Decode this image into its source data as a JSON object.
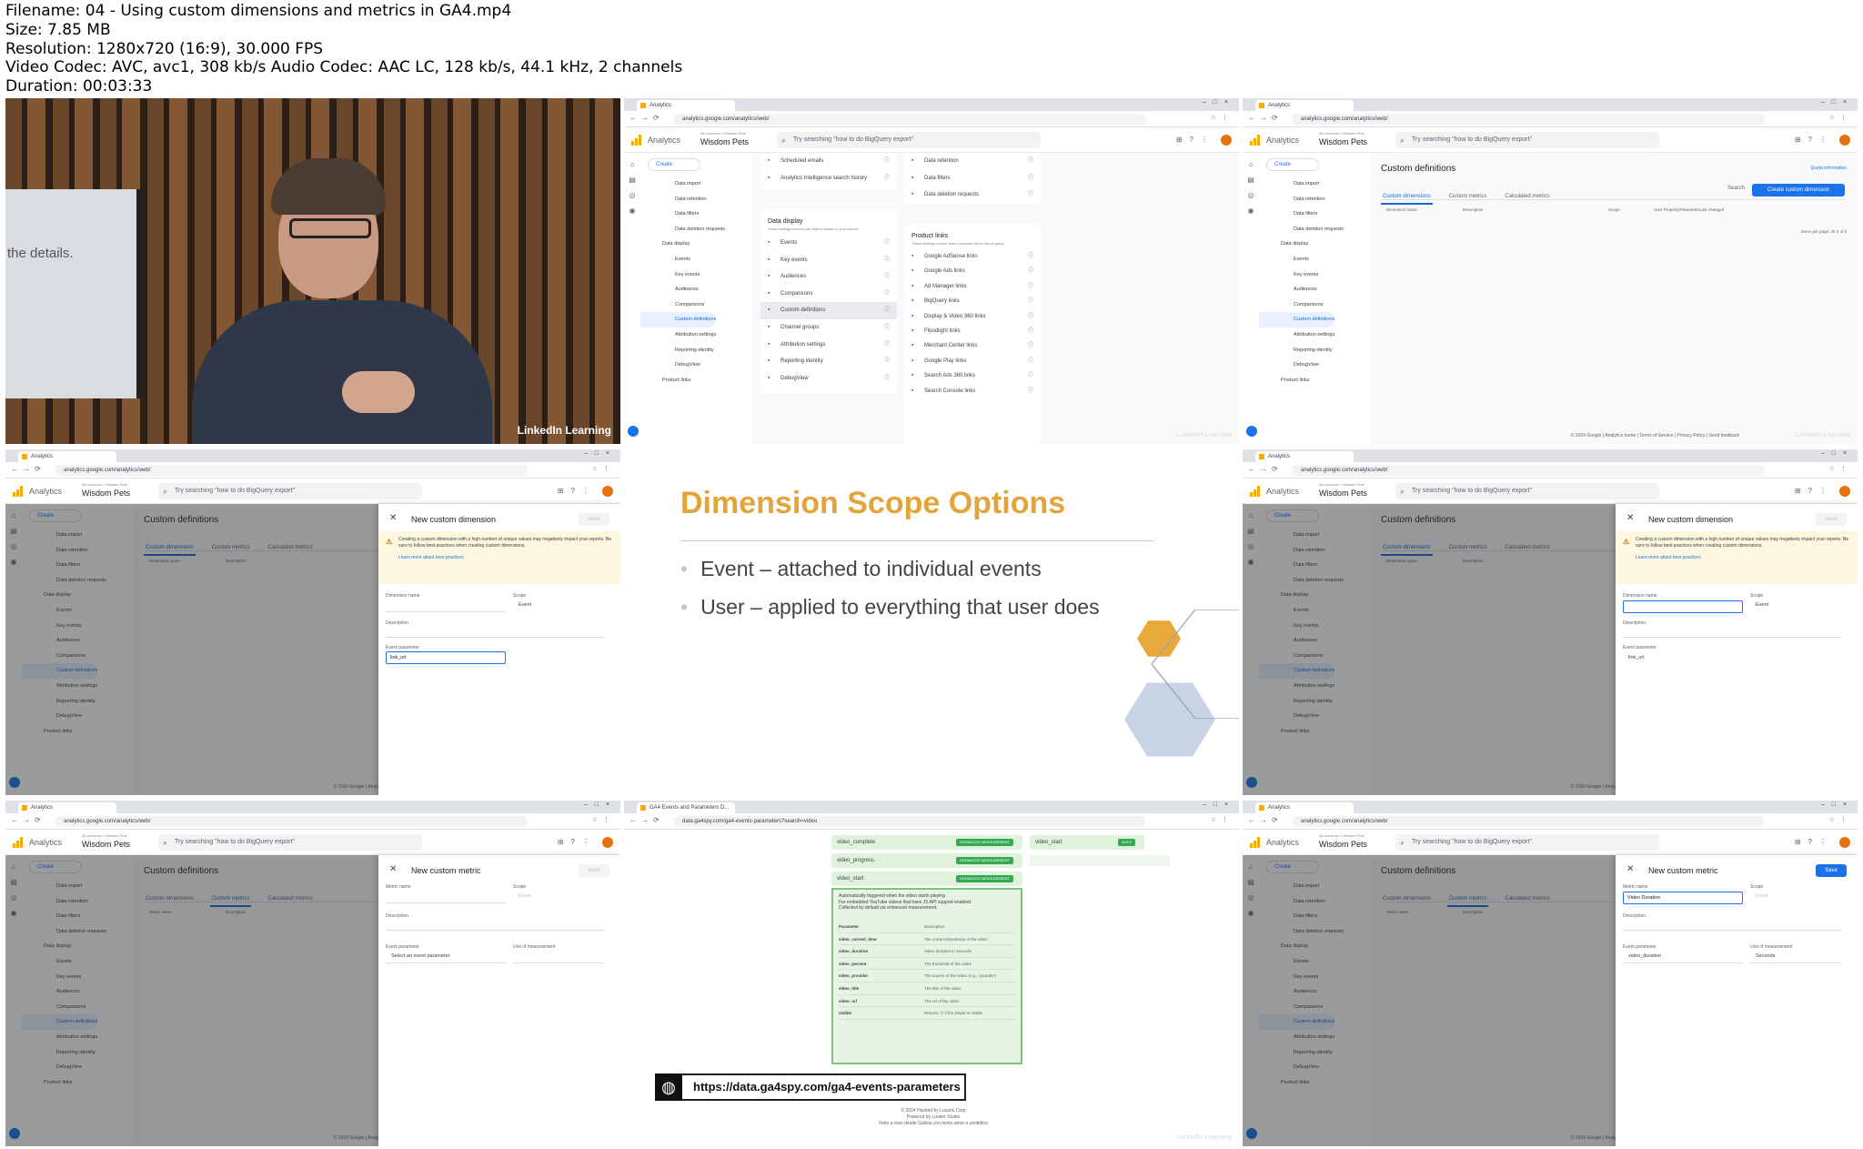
{
  "file_info": {
    "filename": "Filename: 04 - Using custom dimensions and metrics in GA4.mp4",
    "size": "Size: 7.85 MB",
    "resolution": "Resolution: 1280x720 (16:9), 30.000 FPS",
    "codecs": "Video Codec: AVC, avc1, 308 kb/s Audio Codec: AAC LC, 128 kb/s, 44.1 kHz, 2 channels",
    "duration": "Duration: 00:03:33"
  },
  "browser": {
    "tab_title": "Analytics",
    "url": "analytics.google.com/analytics/web/",
    "spy_tab_title": "GA4 Events and Parameters D...",
    "spy_url": "data.ga4spy.com/ga4-events-parameters?search=video"
  },
  "ga": {
    "brand": "Analytics",
    "account_crumb": "All accounts > Wisdom Pets",
    "property": "Wisdom Pets",
    "search_placeholder": "Try searching \"how to do BigQuery export\"",
    "create_label": "Create"
  },
  "sidebar_items": [
    "Data import",
    "Data retention",
    "Data filters",
    "Data deletion requests",
    "Data display",
    "Events",
    "Key events",
    "Audiences",
    "Comparisons",
    "Custom definitions",
    "Channel groups",
    "Attribution settings",
    "Reporting identity",
    "DebugView",
    "Product links"
  ],
  "video": {
    "monitor_text": "the details.",
    "watermark": "LinkedIn Learning"
  },
  "settings": {
    "top_rows": [
      "Scheduled emails",
      "Analytics Intelligence search history"
    ],
    "right_top_rows": [
      "Data retention",
      "Data filters",
      "Data deletion requests"
    ],
    "data_display_title": "Data display",
    "data_display_sub": "These settings control how data is shown in your reports",
    "data_display_rows": [
      "Events",
      "Key events",
      "Audiences",
      "Comparisons",
      "Custom definitions",
      "Channel groups",
      "Attribution settings",
      "Reporting identity",
      "DebugView"
    ],
    "product_links_title": "Product links",
    "product_links_sub": "These settings control which products link to this property",
    "product_links_rows": [
      "Google AdSense links",
      "Google Ads links",
      "Ad Manager links",
      "BigQuery links",
      "Display & Video 360 links",
      "Floodlight links",
      "Merchant Center links",
      "Google Play links",
      "Search Ads 360 links",
      "Search Console links"
    ]
  },
  "custom_defs": {
    "title": "Custom definitions",
    "quick_info": "Quota information",
    "tabs": [
      "Custom dimensions",
      "Custom metrics",
      "Calculated metrics"
    ],
    "create_button": "Create custom dimension",
    "search_label": "Search",
    "dim_columns": [
      "Dimension name",
      "Description",
      "Scope",
      "User Property/Parameter",
      "Last changed"
    ],
    "metric_columns": [
      "Metric name",
      "Description"
    ],
    "pager": "Items per page: 25  0 of 0",
    "footer": "© 2024 Google | Analytics home | Terms of Service | Privacy Policy | Send feedback"
  },
  "panel_dim": {
    "title": "New custom dimension",
    "save": "Save",
    "warning": "Creating a custom dimension with a high number of unique values may negatively impact your reports. Be sure to follow best practices when creating custom dimensions.",
    "learn_more": "Learn more about best practices",
    "dimension_name_label": "Dimension name",
    "scope_label": "Scope",
    "scope_value": "Event",
    "description_label": "Description",
    "event_parameter_label": "Event parameter",
    "event_parameter_value": "link_url"
  },
  "panel_metric": {
    "title": "New custom metric",
    "save": "Save",
    "metric_name_label": "Metric name",
    "scope_label": "Scope",
    "scope_value": "Event",
    "description_label": "Description",
    "event_parameter_label": "Event parameter",
    "event_parameter_placeholder": "Select an event parameter",
    "unit_label": "Unit of measurement",
    "metric_name_value": "Video Duration",
    "event_parameter_value": "video_duration",
    "unit_value": "Seconds"
  },
  "slide": {
    "title": "Dimension Scope Options",
    "bullet1": "Event – attached to individual events",
    "bullet2": "User – applied to everything that user does"
  },
  "spy": {
    "events": [
      "video_complete",
      "video_progress",
      "video_start"
    ],
    "tag": "ENHANCED MEASUREMENT",
    "side_event": "video_start",
    "side_tag": "AUTO",
    "intro1": "Automatically triggered when the video starts playing",
    "intro2": "For embedded YouTube videos that have JS API support enabled.",
    "intro3": "Collected by default via enhanced measurement.",
    "col_param": "Parameter",
    "col_desc": "Description",
    "params": [
      {
        "p": "video_current_time",
        "d": "The current timestamp of the video"
      },
      {
        "p": "video_duration",
        "d": "Video duration in seconds."
      },
      {
        "p": "video_percent",
        "d": "The threshold of the video"
      },
      {
        "p": "video_provider",
        "d": "The source of the video (e.g., 'youtube')"
      },
      {
        "p": "video_title",
        "d": "The title of the video"
      },
      {
        "p": "video_url",
        "d": "The url of the video"
      },
      {
        "p": "visible",
        "d": "Returns '1' if the player is visible"
      }
    ],
    "caption_url": "https://data.ga4spy.com/ga4-events-parameters",
    "foot1": "© 2024 Hacked by Lucaric Corp",
    "foot2": "Powered by Looker Studio",
    "foot3": "Feito a mao desde Galicia con moito amor e sentidino"
  },
  "colors": {
    "accent": "#1a73e8",
    "slide_title": "#e3a43a",
    "hex_gold": "#e8a93a",
    "hex_blue": "#c9d3e6"
  }
}
